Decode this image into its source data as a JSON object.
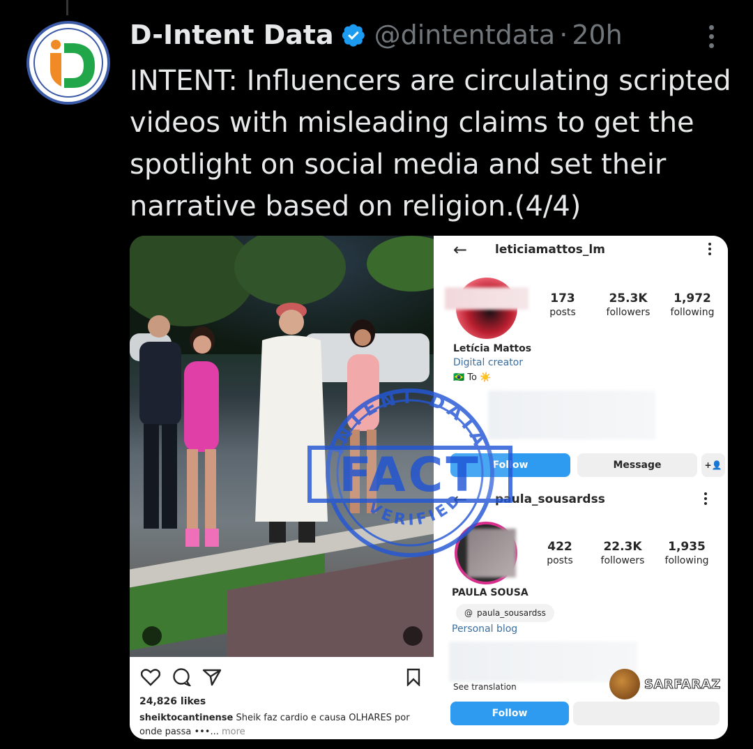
{
  "tweet": {
    "display_name": "D-Intent Data",
    "handle": "@dintentdata",
    "separator": "·",
    "time": "20h",
    "text": "INTENT: Influencers are circulating scripted videos with misleading claims to get the spotlight on social media and set their narrative based on religion.(4/4)"
  },
  "video_post": {
    "likes": "24,826 likes",
    "caption_user": "sheiktocantinense",
    "caption_text": "Sheik faz cardio e causa OLHARES por onde passa",
    "caption_ellipsis": "•••... ",
    "caption_more": "more"
  },
  "profile1": {
    "back": "←",
    "username": "leticiamattos_lm",
    "posts": "173",
    "posts_label": "posts",
    "followers": "25.3K",
    "followers_label": "followers",
    "following": "1,972",
    "following_label": "following",
    "name": "Letícia Mattos",
    "category": "Digital creator",
    "bio": "🇧🇷 To ☀️",
    "follow": "Follow",
    "message": "Message",
    "add": "+👤"
  },
  "profile2": {
    "back": "←",
    "username": "paula_sousardss",
    "posts": "422",
    "posts_label": "posts",
    "followers": "22.3K",
    "followers_label": "followers",
    "following": "1,935",
    "following_label": "following",
    "name": "PAULA SOUSA",
    "threads_handle": "paula_sousardss",
    "category": "Personal blog",
    "see_translation": "See translation",
    "follow": "Follow"
  },
  "stamp": {
    "top": "INTENT DATA",
    "middle": "FACT",
    "bottom": "VERIFIED"
  },
  "watermark": {
    "text": "SARFARAZ"
  },
  "colors": {
    "verified": "#1d9bf0",
    "stamp": "#2457d6",
    "follow_button": "#2f9bf0"
  }
}
